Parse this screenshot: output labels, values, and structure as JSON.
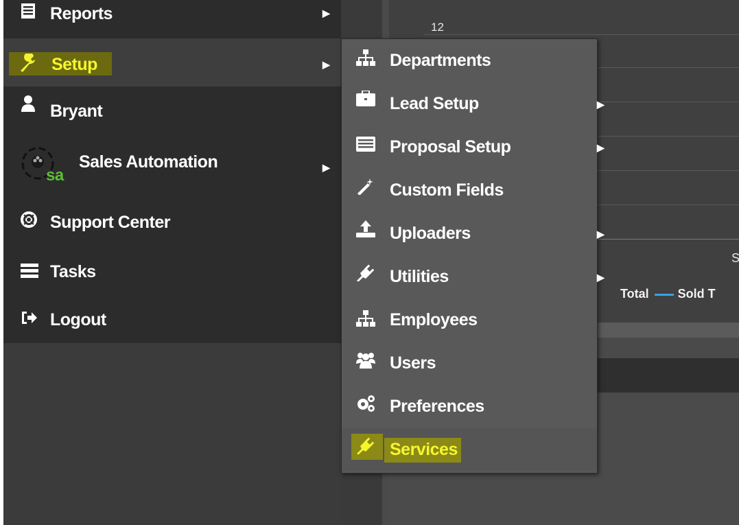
{
  "sidebar": {
    "items": [
      {
        "label": "Reports",
        "icon": "report-icon",
        "has_submenu": true
      },
      {
        "label": "Setup",
        "icon": "wrench-icon",
        "has_submenu": true,
        "active": true,
        "highlighted": true
      },
      {
        "label": "Bryant",
        "icon": "user-icon",
        "has_submenu": false
      },
      {
        "label": "Sales Automation",
        "icon": "sales-automation-logo",
        "logo_text": "sa",
        "has_submenu": true
      },
      {
        "label": "Support Center",
        "icon": "lifebuoy-icon",
        "has_submenu": false
      },
      {
        "label": "Tasks",
        "icon": "tasks-icon",
        "has_submenu": false
      },
      {
        "label": "Logout",
        "icon": "logout-icon",
        "has_submenu": false
      }
    ]
  },
  "submenu": {
    "items": [
      {
        "label": "Departments",
        "icon": "sitemap-icon",
        "has_submenu": false
      },
      {
        "label": "Lead Setup",
        "icon": "briefcase-icon",
        "has_submenu": true
      },
      {
        "label": "Proposal Setup",
        "icon": "list-icon",
        "has_submenu": true
      },
      {
        "label": "Custom Fields",
        "icon": "magic-wand-icon",
        "has_submenu": false
      },
      {
        "label": "Uploaders",
        "icon": "upload-icon",
        "has_submenu": true
      },
      {
        "label": "Utilities",
        "icon": "plug-icon",
        "has_submenu": true
      },
      {
        "label": "Employees",
        "icon": "sitemap-icon",
        "has_submenu": false
      },
      {
        "label": "Users",
        "icon": "users-icon",
        "has_submenu": false
      },
      {
        "label": "Preferences",
        "icon": "gears-icon",
        "has_submenu": false
      },
      {
        "label": "Services",
        "icon": "plug-icon",
        "has_submenu": false,
        "highlighted": true
      }
    ]
  },
  "background_chart": {
    "ytick_top": "12",
    "partial_label": "S",
    "legend": [
      {
        "label": "Total"
      },
      {
        "label": "Sold T"
      }
    ]
  },
  "colors": {
    "highlight": "#e8ea28",
    "legend_line": "#36a3e8",
    "sidebar_bg": "#2c2c2c",
    "submenu_bg": "#595959"
  }
}
